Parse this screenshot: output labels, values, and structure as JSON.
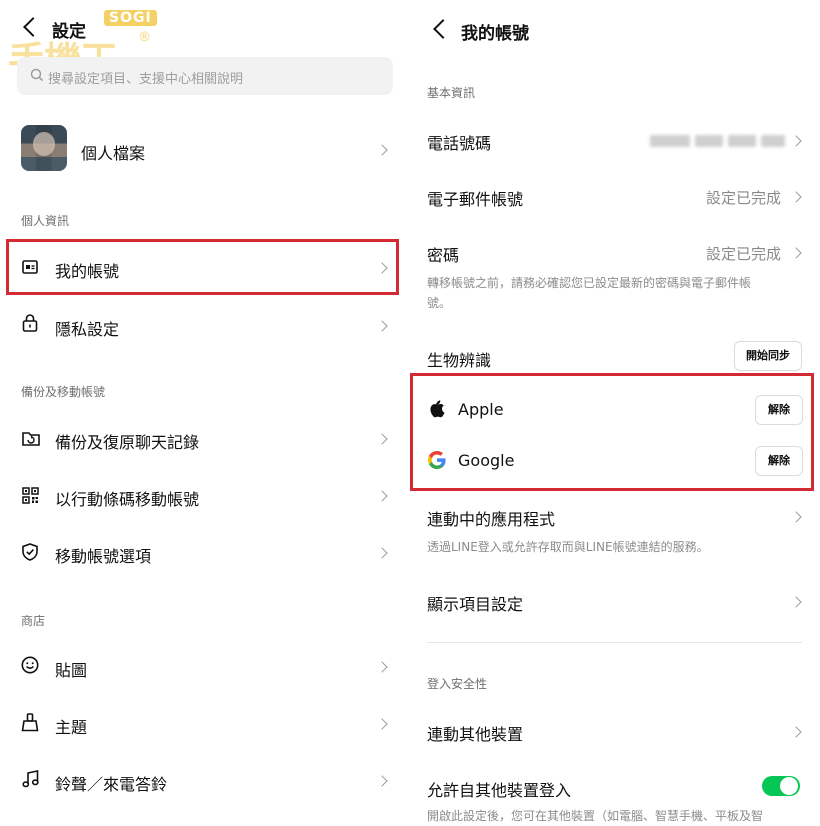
{
  "left": {
    "nav": {
      "title": "設定"
    },
    "watermark": {
      "brand": "SOGI",
      "mark": "手機王",
      "reg": "®"
    },
    "search": {
      "placeholder": "搜尋設定項目、支援中心相關說明"
    },
    "profile": {
      "label": "個人檔案"
    },
    "sections": {
      "personal": "個人資訊",
      "backup": "備份及移動帳號",
      "store": "商店"
    },
    "items": {
      "my_account": "我的帳號",
      "privacy": "隱私設定",
      "backup_restore": "備份及復原聊天記錄",
      "qr_transfer": "以行動條碼移動帳號",
      "transfer_options": "移動帳號選項",
      "stickers": "貼圖",
      "themes": "主題",
      "ringtones": "鈴聲／來電答鈴"
    }
  },
  "right": {
    "nav": {
      "title": "我的帳號"
    },
    "sections": {
      "basic": "基本資訊",
      "login_security": "登入安全性"
    },
    "rows": {
      "phone": "電話號碼",
      "email": "電子郵件帳號",
      "email_status": "設定已完成",
      "password": "密碼",
      "password_status": "設定已完成",
      "password_hint_1": "轉移帳號之前，請務必確認您已設定最新的密碼與電子郵件帳",
      "password_hint_2": "號。",
      "biometric": "生物辨識",
      "biometric_button": "開始同步",
      "apple": "Apple",
      "apple_button": "解除",
      "google": "Google",
      "google_button": "解除",
      "linked_apps": "連動中的應用程式",
      "linked_apps_hint": "透過LINE登入或允許存取而與LINE帳號連結的服務。",
      "display_settings": "顯示項目設定",
      "other_devices": "連動其他裝置",
      "allow_other_login": "允許自其他裝置登入",
      "allow_other_login_hint": "開啟此設定後，您可在其他裝置（如電腦、智慧手機、平板及智"
    },
    "toggle": {
      "allow_other_login": true
    }
  },
  "colors": {
    "highlight": "#d42a34",
    "toggle_on": "#06c755",
    "text_secondary": "#8a8a8a"
  }
}
